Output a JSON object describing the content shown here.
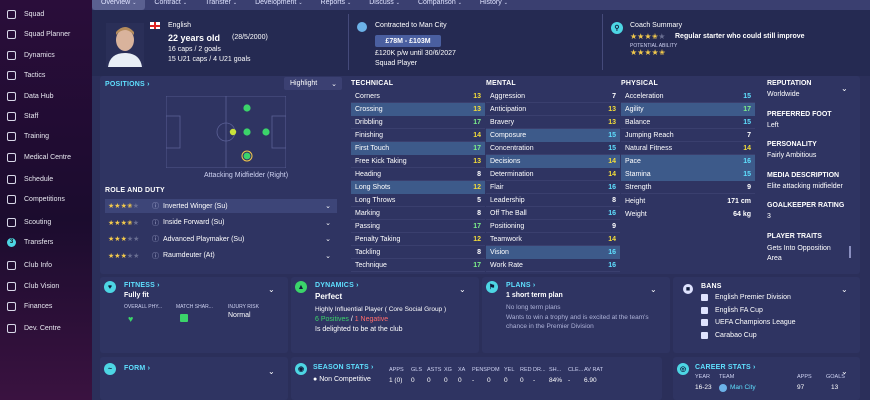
{
  "sidebar": {
    "items": [
      {
        "label": "Squad",
        "icon": "shirt-icon"
      },
      {
        "label": "Squad Planner",
        "icon": "planner-icon"
      },
      {
        "label": "Dynamics",
        "icon": "dynamics-icon"
      },
      {
        "label": "Tactics",
        "icon": "tactics-icon"
      },
      {
        "label": "Data Hub",
        "icon": "data-hub-icon"
      },
      {
        "label": "Staff",
        "icon": "staff-icon"
      },
      {
        "label": "Training",
        "icon": "training-icon"
      },
      {
        "label": "Medical Centre",
        "icon": "medical-icon"
      },
      {
        "label": "Schedule",
        "icon": "calendar-icon"
      },
      {
        "label": "Competitions",
        "icon": "trophy-icon"
      },
      {
        "label": "Scouting",
        "icon": "scouting-icon"
      },
      {
        "label": "Transfers",
        "icon": "transfers-icon",
        "badge": "3"
      },
      {
        "label": "Club Info",
        "icon": "club-info-icon"
      },
      {
        "label": "Club Vision",
        "icon": "vision-icon"
      },
      {
        "label": "Finances",
        "icon": "finances-icon"
      },
      {
        "label": "Dev. Centre",
        "icon": "dev-centre-icon"
      }
    ]
  },
  "tabs": [
    "Overview",
    "Contract",
    "Transfer",
    "Development",
    "Reports",
    "Discuss",
    "Comparison",
    "History"
  ],
  "player": {
    "nationality": "English",
    "age_line": "22 years old",
    "dob": "(28/5/2000)",
    "caps_line1": "16 caps / 2 goals",
    "caps_line2": "15 U21 caps / 4 U21 goals"
  },
  "contract": {
    "title": "Contracted to Man City",
    "value": "£78M - £103M",
    "wage": "£120K p/w until 30/6/2027",
    "status": "Squad Player"
  },
  "coach": {
    "title": "Coach Summary",
    "summary": "Regular starter who could still improve",
    "potential_label": "POTENTIAL ABILITY",
    "current_stars": 3.5,
    "potential_stars": 4.5
  },
  "positions": {
    "title": "POSITIONS",
    "highlight": "Highlight",
    "position_caption": "Attacking Midfielder (Right)"
  },
  "role_duty": {
    "title": "ROLE AND DUTY",
    "roles": [
      {
        "stars": 3.5,
        "label": "Inverted Winger (Su)"
      },
      {
        "stars": 3.5,
        "label": "Inside Forward (Su)"
      },
      {
        "stars": 3,
        "label": "Advanced Playmaker (Su)"
      },
      {
        "stars": 3,
        "label": "Raumdeuter (At)"
      }
    ]
  },
  "technical": {
    "title": "TECHNICAL",
    "attrs": [
      {
        "n": "Corners",
        "v": "13",
        "c": "y",
        "hl": false
      },
      {
        "n": "Crossing",
        "v": "13",
        "c": "y",
        "hl": true
      },
      {
        "n": "Dribbling",
        "v": "17",
        "c": "g",
        "hl": false
      },
      {
        "n": "Finishing",
        "v": "14",
        "c": "y",
        "hl": false
      },
      {
        "n": "First Touch",
        "v": "17",
        "c": "g",
        "hl": true
      },
      {
        "n": "Free Kick Taking",
        "v": "13",
        "c": "y",
        "hl": false
      },
      {
        "n": "Heading",
        "v": "8",
        "c": "w",
        "hl": false
      },
      {
        "n": "Long Shots",
        "v": "12",
        "c": "y",
        "hl": true
      },
      {
        "n": "Long Throws",
        "v": "5",
        "c": "w",
        "hl": false
      },
      {
        "n": "Marking",
        "v": "8",
        "c": "w",
        "hl": false
      },
      {
        "n": "Passing",
        "v": "17",
        "c": "g",
        "hl": false
      },
      {
        "n": "Penalty Taking",
        "v": "12",
        "c": "y",
        "hl": false
      },
      {
        "n": "Tackling",
        "v": "8",
        "c": "w",
        "hl": false
      },
      {
        "n": "Technique",
        "v": "17",
        "c": "g",
        "hl": false
      }
    ]
  },
  "mental": {
    "title": "MENTAL",
    "attrs": [
      {
        "n": "Aggression",
        "v": "7",
        "c": "w",
        "hl": false
      },
      {
        "n": "Anticipation",
        "v": "13",
        "c": "y",
        "hl": false
      },
      {
        "n": "Bravery",
        "v": "13",
        "c": "y",
        "hl": false
      },
      {
        "n": "Composure",
        "v": "15",
        "c": "c",
        "hl": true
      },
      {
        "n": "Concentration",
        "v": "15",
        "c": "c",
        "hl": false
      },
      {
        "n": "Decisions",
        "v": "14",
        "c": "y",
        "hl": true
      },
      {
        "n": "Determination",
        "v": "14",
        "c": "y",
        "hl": false
      },
      {
        "n": "Flair",
        "v": "16",
        "c": "c",
        "hl": false
      },
      {
        "n": "Leadership",
        "v": "8",
        "c": "w",
        "hl": false
      },
      {
        "n": "Off The Ball",
        "v": "16",
        "c": "c",
        "hl": false
      },
      {
        "n": "Positioning",
        "v": "9",
        "c": "w",
        "hl": false
      },
      {
        "n": "Teamwork",
        "v": "14",
        "c": "y",
        "hl": false
      },
      {
        "n": "Vision",
        "v": "16",
        "c": "c",
        "hl": true
      },
      {
        "n": "Work Rate",
        "v": "16",
        "c": "c",
        "hl": false
      }
    ]
  },
  "physical": {
    "title": "PHYSICAL",
    "attrs": [
      {
        "n": "Acceleration",
        "v": "15",
        "c": "c",
        "hl": false
      },
      {
        "n": "Agility",
        "v": "17",
        "c": "g",
        "hl": true
      },
      {
        "n": "Balance",
        "v": "15",
        "c": "c",
        "hl": false
      },
      {
        "n": "Jumping Reach",
        "v": "7",
        "c": "w",
        "hl": false
      },
      {
        "n": "Natural Fitness",
        "v": "14",
        "c": "y",
        "hl": false
      },
      {
        "n": "Pace",
        "v": "16",
        "c": "c",
        "hl": true
      },
      {
        "n": "Stamina",
        "v": "15",
        "c": "c",
        "hl": true
      },
      {
        "n": "Strength",
        "v": "9",
        "c": "w",
        "hl": false
      }
    ],
    "height_label": "Height",
    "height": "171 cm",
    "weight_label": "Weight",
    "weight": "64 kg"
  },
  "info": {
    "reputation_label": "REPUTATION",
    "reputation": "Worldwide",
    "foot_label": "PREFERRED FOOT",
    "foot": "Left",
    "personality_label": "PERSONALITY",
    "personality": "Fairly Ambitious",
    "media_label": "MEDIA DESCRIPTION",
    "media": "Elite attacking midfielder",
    "gk_label": "GOALKEEPER RATING",
    "gk": "3",
    "traits_label": "PLAYER TRAITS",
    "traits": "Gets Into Opposition Area"
  },
  "fitness": {
    "title": "FITNESS",
    "status": "Fully fit",
    "col1": "OVERALL PHY...",
    "col2": "MATCH SHAR...",
    "col3": "INJURY RISK",
    "risk": "Normal"
  },
  "dynamics": {
    "title": "DYNAMICS",
    "status": "Perfect",
    "influence": "Highly Influential Player ( Core Social Group )",
    "positives": "6 Positives",
    "sep": "/",
    "negatives": "1 Negative",
    "happy": "Is delighted to be at the club"
  },
  "plans": {
    "title": "PLANS",
    "count": "1 short term plan",
    "p1": "No long term plans",
    "p2": "Wants to win a trophy and is excited at the team's chance in the Premier Division"
  },
  "bans": {
    "title": "BANS",
    "items": [
      "English Premier Division",
      "English FA Cup",
      "UEFA Champions League",
      "Carabao Cup"
    ]
  },
  "form": {
    "title": "FORM"
  },
  "season": {
    "title": "SEASON STATS",
    "headers": [
      "APPS",
      "GLS",
      "ASTS",
      "XG",
      "XA",
      "PENS",
      "POM",
      "YEL",
      "RED",
      "DR...",
      "SH...",
      "CLE...",
      "AV RAT"
    ],
    "row_label": "Non Competitive",
    "row": [
      "1 (0)",
      "0",
      "0",
      "0",
      "0",
      "-",
      "0",
      "0",
      "0",
      "-",
      "84%",
      "-",
      "6.90"
    ]
  },
  "career": {
    "title": "CAREER STATS",
    "h_year": "YEAR",
    "h_team": "TEAM",
    "h_apps": "APPS",
    "h_goals": "GOALS",
    "year": "16-23",
    "team": "Man City",
    "apps": "97",
    "goals": "13"
  },
  "colors": {
    "accent": "#5fe0ff",
    "bg": "#2b2f5a",
    "panel": "#2f3462",
    "highlight_row": "#3d5a8a"
  }
}
